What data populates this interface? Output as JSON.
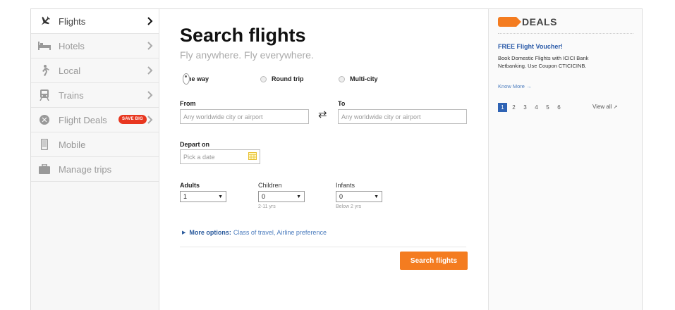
{
  "sidebar": {
    "items": [
      {
        "label": "Flights",
        "icon": "airplane-icon",
        "active": true
      },
      {
        "label": "Hotels",
        "icon": "bed-icon"
      },
      {
        "label": "Local",
        "icon": "person-walking-icon"
      },
      {
        "label": "Trains",
        "icon": "train-icon"
      },
      {
        "label": "Flight Deals",
        "icon": "deal-tag-icon",
        "badge": "SAVE BIG"
      },
      {
        "label": "Mobile",
        "icon": "mobile-phone-icon"
      },
      {
        "label": "Manage trips",
        "icon": "briefcase-icon"
      }
    ]
  },
  "main": {
    "title": "Search flights",
    "subtitle": "Fly anywhere. Fly everywhere.",
    "trip_types": [
      {
        "label": "One way",
        "selected": true
      },
      {
        "label": "Round trip",
        "selected": false
      },
      {
        "label": "Multi-city",
        "selected": false
      }
    ],
    "from": {
      "label": "From",
      "placeholder": "Any worldwide city or airport"
    },
    "to": {
      "label": "To",
      "placeholder": "Any worldwide city or airport"
    },
    "depart": {
      "label": "Depart on",
      "placeholder": "Pick a date"
    },
    "adults": {
      "label": "Adults",
      "value": "1"
    },
    "children": {
      "label": "Children",
      "value": "0",
      "hint": "2-11 yrs"
    },
    "infants": {
      "label": "Infants",
      "value": "0",
      "hint": "Below 2 yrs"
    },
    "more_options": {
      "label": "More options:",
      "detail": "Class of travel, Airline preference"
    },
    "search_button": "Search flights"
  },
  "deals": {
    "title": "DEALS",
    "deal": {
      "title": "FREE Flight Voucher!",
      "description": "Book Domestic Flights with ICICI Bank Netbanking. Use Coupon CTICICINB.",
      "link": "Know More →"
    },
    "pages": [
      "1",
      "2",
      "3",
      "4",
      "5",
      "6"
    ],
    "current_page": "1",
    "view_all": "View all"
  },
  "colors": {
    "accent": "#f47c20",
    "link": "#2a5aa8",
    "badge": "#e8361f",
    "pager_active": "#2f63b4"
  }
}
